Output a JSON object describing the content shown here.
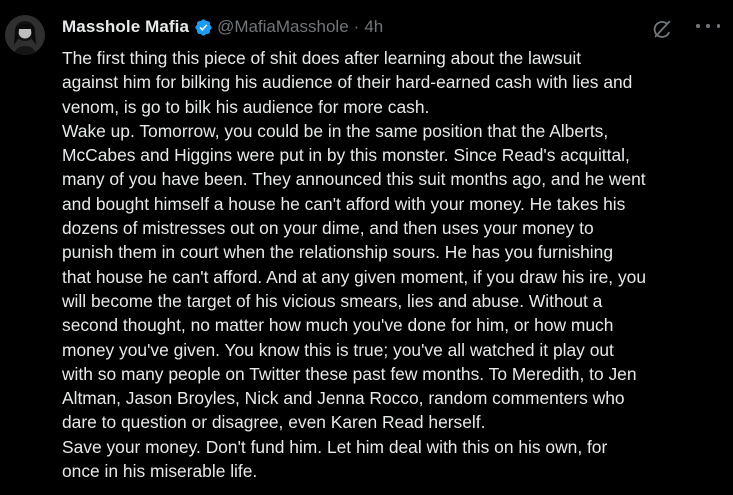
{
  "author": {
    "display_name": "Masshole Mafia",
    "handle": "@MafiaMasshole",
    "separator": "·",
    "time": "4h",
    "verified": true
  },
  "icons": {
    "verified": "verified-badge-icon",
    "grok": "grok-icon",
    "more": "more-options-icon"
  },
  "colors": {
    "background": "#000000",
    "text": "#e7e9ea",
    "muted": "#71767b",
    "verified_blue": "#1d9bf0"
  },
  "post": {
    "lines": [
      "The first thing this piece of shit does after learning about the lawsuit",
      "against him for bilking his audience of their hard-earned cash with lies and",
      "venom, is go to bilk his audience for more cash.",
      "Wake up. Tomorrow, you could be in the same position that the Alberts,",
      "McCabes and Higgins were put in by this monster. Since Read's acquittal,",
      "many of you have been. They announced this suit months ago, and he went",
      "and bought himself a house he can't afford with your money. He takes his",
      "dozens of mistresses out on your dime, and then uses your money to",
      "punish them in court when the relationship sours. He has you furnishing",
      "that house he can't afford. And at any given moment, if you draw his ire, you",
      "will become the target of his vicious smears, lies and abuse. Without a",
      "second thought, no matter how much you've done for him, or how much",
      "money you've given. You know this is true; you've all watched it play out",
      "with so many people on Twitter these past few months. To Meredith, to Jen",
      "Altman, Jason Broyles,  Nick and Jenna Rocco, random commenters who",
      "dare to question or disagree, even Karen Read herself.",
      "Save your money. Don't fund him. Let him deal with this on his own, for",
      "once in his miserable life."
    ]
  }
}
